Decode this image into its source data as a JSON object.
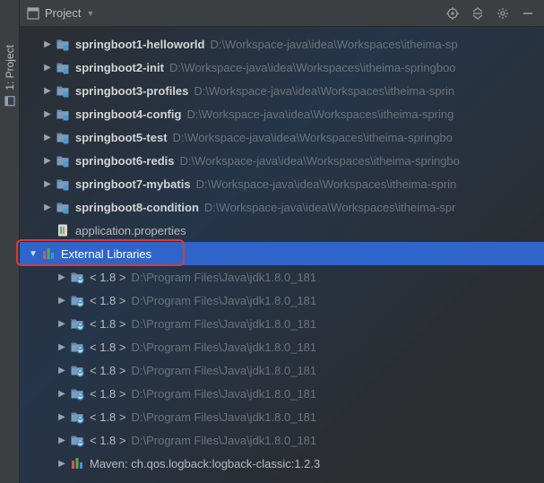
{
  "sidebar": {
    "tab_label": "1: Project"
  },
  "toolbar": {
    "title": "Project"
  },
  "modules": [
    {
      "name": "springboot1-helloworld",
      "path": "D:\\Workspace-java\\idea\\Workspaces\\itheima-sp"
    },
    {
      "name": "springboot2-init",
      "path": "D:\\Workspace-java\\idea\\Workspaces\\itheima-springboo"
    },
    {
      "name": "springboot3-profiles",
      "path": "D:\\Workspace-java\\idea\\Workspaces\\itheima-sprin"
    },
    {
      "name": "springboot4-config",
      "path": "D:\\Workspace-java\\idea\\Workspaces\\itheima-spring"
    },
    {
      "name": "springboot5-test",
      "path": "D:\\Workspace-java\\idea\\Workspaces\\itheima-springbo"
    },
    {
      "name": "springboot6-redis",
      "path": "D:\\Workspace-java\\idea\\Workspaces\\itheima-springbo"
    },
    {
      "name": "springboot7-mybatis",
      "path": "D:\\Workspace-java\\idea\\Workspaces\\itheima-sprin"
    },
    {
      "name": "springboot8-condition",
      "path": "D:\\Workspace-java\\idea\\Workspaces\\itheima-spr"
    }
  ],
  "file": {
    "name": "application.properties"
  },
  "ext_lib": {
    "label": "External Libraries"
  },
  "jdks": [
    {
      "label": "< 1.8 >",
      "path": "D:\\Program Files\\Java\\jdk1.8.0_181"
    },
    {
      "label": "< 1.8 >",
      "path": "D:\\Program Files\\Java\\jdk1.8.0_181"
    },
    {
      "label": "< 1.8 >",
      "path": "D:\\Program Files\\Java\\jdk1.8.0_181"
    },
    {
      "label": "< 1.8 >",
      "path": "D:\\Program Files\\Java\\jdk1.8.0_181"
    },
    {
      "label": "< 1.8 >",
      "path": "D:\\Program Files\\Java\\jdk1.8.0_181"
    },
    {
      "label": "< 1.8 >",
      "path": "D:\\Program Files\\Java\\jdk1.8.0_181"
    },
    {
      "label": "< 1.8 >",
      "path": "D:\\Program Files\\Java\\jdk1.8.0_181"
    },
    {
      "label": "< 1.8 >",
      "path": "D:\\Program Files\\Java\\jdk1.8.0_181"
    }
  ],
  "maven": {
    "label": "Maven: ch.qos.logback:logback-classic:1.2.3"
  }
}
